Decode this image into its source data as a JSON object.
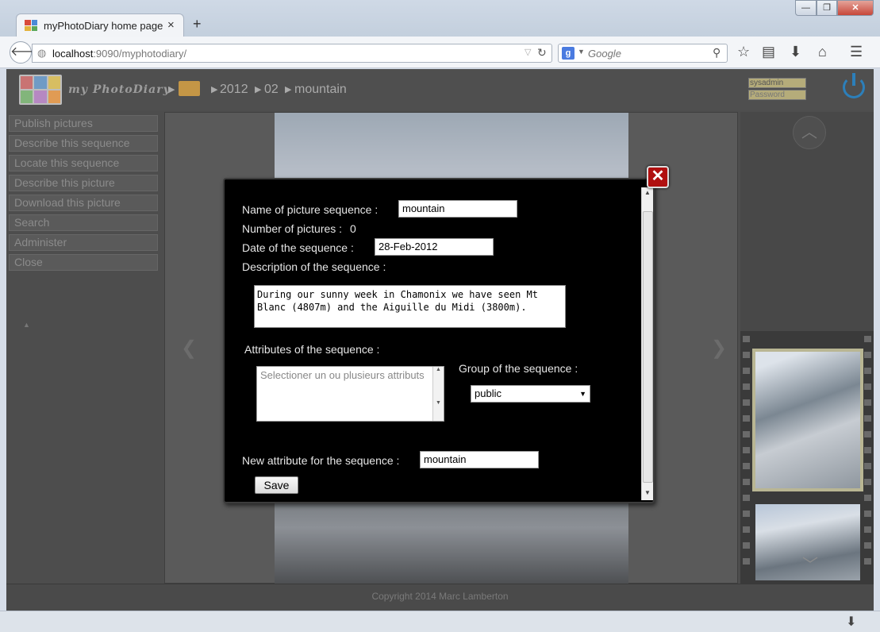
{
  "browser": {
    "tab_title": "myPhotoDiary home page",
    "tab_close": "×",
    "new_tab": "+",
    "url_host": "localhost",
    "url_path": ":9090/myphotodiary/",
    "search_placeholder": "Google",
    "search_engine_letter": "g",
    "window_min": "—",
    "window_max": "❐",
    "window_close": "✕"
  },
  "header": {
    "logo_text": "my PhotoDiary",
    "breadcrumb": [
      "2012",
      "02",
      "mountain"
    ],
    "username": "sysadmin",
    "password_placeholder": "Password"
  },
  "sidebar": {
    "items": [
      "Publish pictures",
      "Describe this sequence",
      "Locate this sequence",
      "Describe this picture",
      "Download this picture",
      "Search",
      "Administer",
      "Close"
    ]
  },
  "footer": {
    "copyright": "Copyright 2014 Marc Lamberton"
  },
  "modal": {
    "name_label": "Name of picture sequence :",
    "name_value": "mountain",
    "count_label": "Number of pictures :",
    "count_value": "0",
    "date_label": "Date of the sequence :",
    "date_value": "28-Feb-2012",
    "description_label": "Description of the sequence :",
    "description_value": "During our sunny week in Chamonix we have seen Mt Blanc (4807m) and the Aiguille du Midi (3800m).",
    "attributes_label": "Attributes of the sequence :",
    "attributes_placeholder": "Selectioner un ou plusieurs attributs",
    "group_label": "Group of the sequence :",
    "group_value": "public",
    "new_attribute_label": "New attribute for the sequence :",
    "new_attribute_value": "mountain",
    "save_label": "Save",
    "close_label": "✕"
  },
  "colors": {
    "accent_close": "#b01010",
    "power_icon": "#2c7fba",
    "folder": "#c49646"
  }
}
